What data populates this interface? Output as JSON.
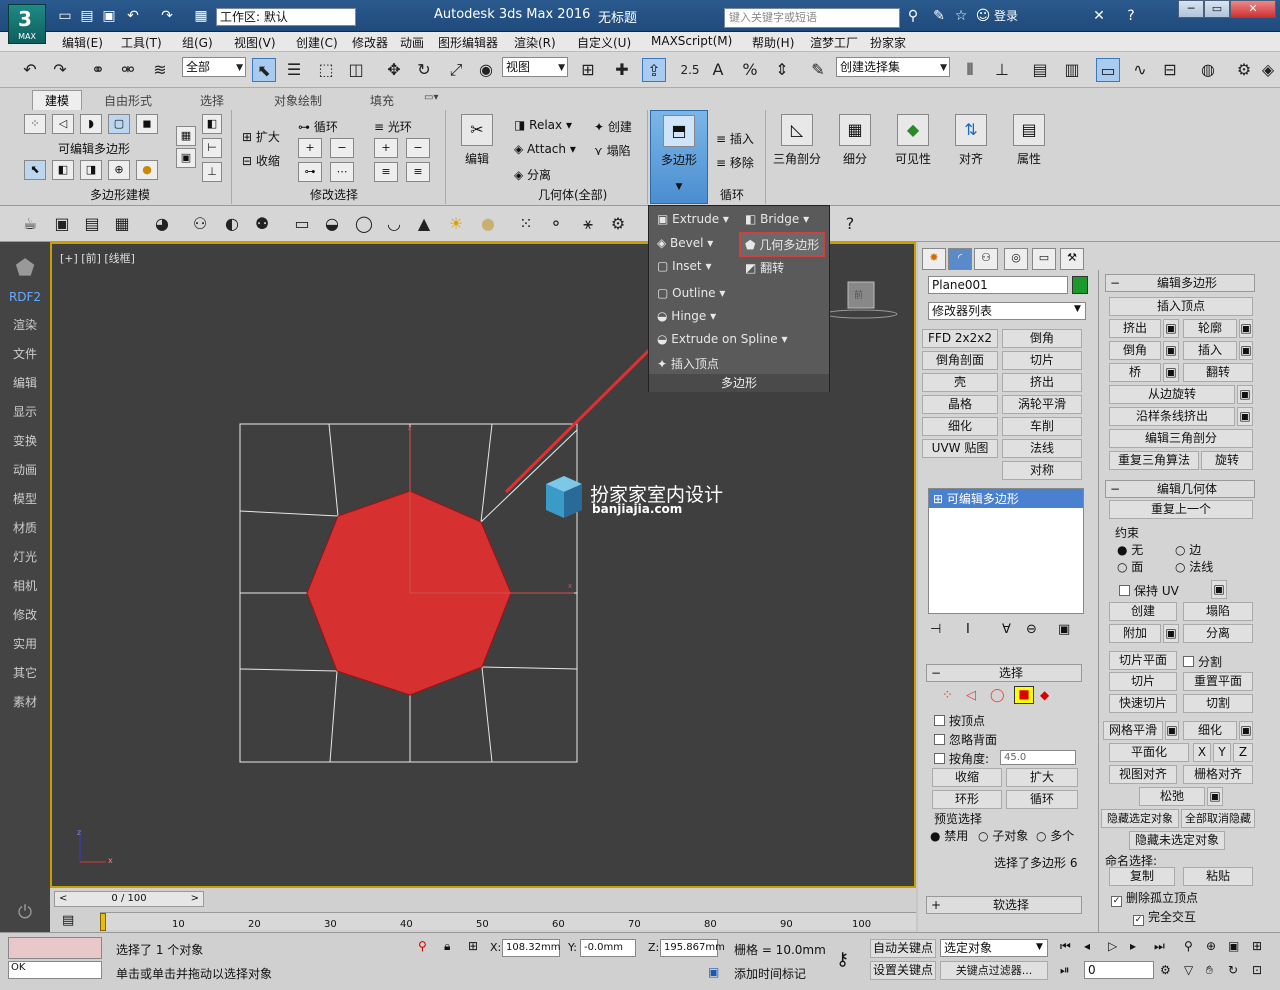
{
  "app": {
    "logo_text": "MAX",
    "workspace": "工作区: 默认",
    "title": "Autodesk 3ds Max 2016",
    "doc": "无标题",
    "search_placeholder": "键入关键字或短语",
    "login": "登录"
  },
  "menu": [
    "编辑(E)",
    "工具(T)",
    "组(G)",
    "视图(V)",
    "创建(C)",
    "修改器",
    "动画",
    "图形编辑器",
    "渲染(R)",
    "自定义(U)",
    "MAXScript(M)",
    "帮助(H)",
    "渲梦工厂",
    "扮家家"
  ],
  "toolbar": {
    "filter": "全部",
    "view": "视图",
    "selset": "创建选择集",
    "snap_num": "2.5",
    "angle_icon": "A",
    "pct_icon": "%"
  },
  "ribbon": {
    "tabs": [
      "建模",
      "自由形式",
      "选择",
      "对象绘制",
      "填充"
    ],
    "poly_label": "可编辑多边形",
    "panel1": "多边形建模",
    "panel2": "修改选择",
    "panel3": "几何体(全部)",
    "panel4": "循环",
    "grow": "扩大",
    "shrink": "收缩",
    "loop": "循环",
    "ring": "光环",
    "edit": "编辑",
    "relax": "Relax",
    "create": "创建",
    "attach": "Attach",
    "collapse": "塌陷",
    "detach": "分离",
    "polygon": "多边形",
    "insert": "插入",
    "remove": "移除",
    "tri": "三角剖分",
    "subdiv": "细分",
    "visible": "可见性",
    "align": "对齐",
    "props": "属性"
  },
  "popup": {
    "extrude": "Extrude",
    "bridge": "Bridge",
    "bevel": "Bevel",
    "geo_poly": "几何多边形",
    "inset": "Inset",
    "flip": "翻转",
    "outline": "Outline",
    "hinge": "Hinge",
    "extrude_spline": "Extrude  on Spline",
    "insert_vertex": "插入顶点",
    "footer": "多边形"
  },
  "left_nav": [
    "RDF2",
    "渲染",
    "文件",
    "编辑",
    "显示",
    "变换",
    "动画",
    "模型",
    "材质",
    "灯光",
    "相机",
    "修改",
    "实用",
    "其它",
    "素材"
  ],
  "viewport": {
    "label": "[+] [前] [线框]",
    "watermark_cn": "扮家家室内设计",
    "watermark_en": "banjiajia.com",
    "cube_label": "前",
    "axis_x": "x",
    "axis_z": "z"
  },
  "panel": {
    "object_name": "Plane001",
    "modifier_list": "修改器列表",
    "mods": [
      "FFD 2x2x2",
      "倒角",
      "倒角剖面",
      "切片",
      "壳",
      "挤出",
      "晶格",
      "涡轮平滑",
      "细化",
      "车削",
      "UVW 贴图",
      "法线",
      "",
      "对称"
    ],
    "stack_item": "可编辑多边形",
    "sel_title": "选择",
    "by_vertex": "按顶点",
    "ignore_back": "忽略背面",
    "by_angle": "按角度:",
    "angle_val": "45.0",
    "shrink": "收缩",
    "grow": "扩大",
    "ring": "环形",
    "loop": "循环",
    "preview": "预览选择",
    "disable": "禁用",
    "subobj": "子对象",
    "multi": "多个",
    "sel_status": "选择了多边形 6",
    "soft_sel": "软选择"
  },
  "panel2": {
    "edit_poly": "编辑多边形",
    "insert_vertex": "插入顶点",
    "extrude": "挤出",
    "outline": "轮廓",
    "bevel": "倒角",
    "inset": "插入",
    "bridge": "桥",
    "flip": "翻转",
    "hinge": "从边旋转",
    "spline": "沿样条线挤出",
    "edit_tri": "编辑三角剖分",
    "retri": "重复三角算法",
    "turn": "旋转",
    "edit_geo": "编辑几何体",
    "repeat": "重复上一个",
    "constraint": "约束",
    "none": "无",
    "edge": "边",
    "face": "面",
    "normal": "法线",
    "keep_uv": "保持 UV",
    "create": "创建",
    "collapse": "塌陷",
    "attach": "附加",
    "detach": "分离",
    "slice_plane": "切片平面",
    "split": "分割",
    "slice": "切片",
    "reset_plane": "重置平面",
    "quickslice": "快速切片",
    "cut": "切割",
    "meshsmooth": "网格平滑",
    "tess": "细化",
    "planar": "平面化",
    "x": "X",
    "y": "Y",
    "z": "Z",
    "view_align": "视图对齐",
    "grid_align": "栅格对齐",
    "relax": "松弛",
    "hide_sel": "隐藏选定对象",
    "unhide_all": "全部取消隐藏",
    "hide_unsel": "隐藏未选定对象",
    "named_sel": "命名选择:",
    "copy": "复制",
    "paste": "粘贴",
    "del_iso": "删除孤立顶点",
    "full_inter": "完全交互"
  },
  "timeline": {
    "frame": "0 / 100",
    "ticks": [
      "10",
      "20",
      "30",
      "40",
      "50",
      "60",
      "70",
      "80",
      "90",
      "100"
    ]
  },
  "status": {
    "ok": "OK",
    "selected": "选择了 1 个对象",
    "hint": "单击或单击并拖动以选择对象",
    "x_label": "X:",
    "x": "108.32mm",
    "y_label": "Y:",
    "y": "-0.0mm",
    "z_label": "Z:",
    "z": "195.867mm",
    "grid": "栅格 = 10.0mm",
    "autokey": "自动关键点",
    "setkey": "设置关键点",
    "selobj": "选定对象",
    "keyfilter": "关键点过滤器...",
    "addtime": "添加时间标记",
    "frame_val": "0"
  },
  "colors": {
    "accent": "#4a8ed0",
    "polygon": "#d63030",
    "viewport_bg": "#3f3f3f",
    "highlight": "#d04040"
  }
}
